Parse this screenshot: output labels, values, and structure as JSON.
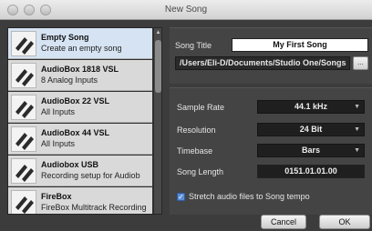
{
  "window": {
    "title": "New Song"
  },
  "templates": [
    {
      "title": "Empty Song",
      "subtitle": "Create an empty song",
      "selected": true
    },
    {
      "title": "AudioBox 1818 VSL",
      "subtitle": "8 Analog Inputs",
      "selected": false
    },
    {
      "title": "AudioBox 22 VSL",
      "subtitle": "All Inputs",
      "selected": false
    },
    {
      "title": "AudioBox 44 VSL",
      "subtitle": "All Inputs",
      "selected": false
    },
    {
      "title": "Audiobox USB",
      "subtitle": "Recording setup for Audiob",
      "selected": false
    },
    {
      "title": "FireBox",
      "subtitle": "FireBox Multitrack Recording",
      "selected": false
    }
  ],
  "song": {
    "title_label": "Song Title",
    "title_value": "My First Song",
    "path": "/Users/Eli-D/Documents/Studio One/Songs",
    "browse_label": "...",
    "sample_rate_label": "Sample Rate",
    "sample_rate": "44.1 kHz",
    "resolution_label": "Resolution",
    "resolution": "24 Bit",
    "timebase_label": "Timebase",
    "timebase": "Bars",
    "length_label": "Song Length",
    "length": "0151.01.01.00",
    "stretch_label": "Stretch audio files to Song tempo",
    "stretch_checked": true
  },
  "buttons": {
    "cancel": "Cancel",
    "ok": "OK"
  },
  "colors": {
    "accent": "#5b8ed8",
    "selected_row": "#d5e3f3"
  }
}
